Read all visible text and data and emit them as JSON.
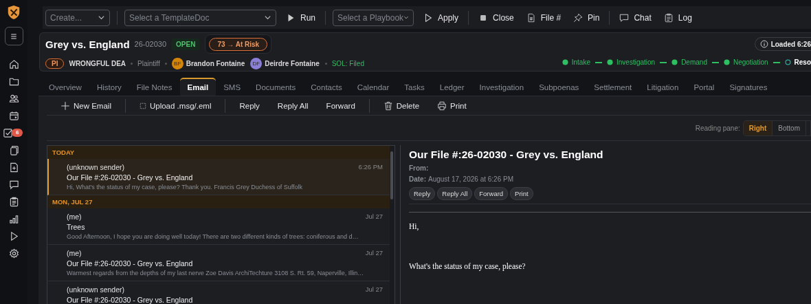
{
  "sidebar": {
    "task_badge": "6"
  },
  "toolbar": {
    "items": [
      {
        "kind": "dropdown",
        "placeholder": "Create..."
      },
      {
        "kind": "divider"
      },
      {
        "kind": "dropdown",
        "placeholder": "Select a TemplateDoc"
      },
      {
        "kind": "button",
        "label": "Run"
      },
      {
        "kind": "divider"
      },
      {
        "kind": "dropdown",
        "placeholder": "Select a Playbook"
      },
      {
        "kind": "button",
        "label": "Apply"
      },
      {
        "kind": "divider"
      },
      {
        "kind": "button",
        "label": "Close"
      },
      {
        "kind": "button",
        "label": "File #"
      },
      {
        "kind": "button",
        "label": "Pin"
      },
      {
        "kind": "divider"
      },
      {
        "kind": "button",
        "label": "Chat"
      },
      {
        "kind": "button",
        "label": "Log"
      }
    ]
  },
  "case": {
    "title": "Grey vs. England",
    "number": "26-02030",
    "status": "OPEN",
    "risk": "73 → At Risk",
    "practice": "PI",
    "case_type": "WRONGFUL DEA",
    "role": "Plaintiff",
    "people": [
      {
        "initials": "BF",
        "name": "Brandon Fontaine",
        "color": "#d4860b"
      },
      {
        "initials": "DF",
        "name": "Deirdre Fontaine",
        "color": "#8a7fd6"
      }
    ],
    "sol": "SOL: Filed",
    "loaded": "Loaded 6:26",
    "stages": [
      {
        "label": "Intake",
        "completed": true
      },
      {
        "label": "Investigation",
        "completed": true
      },
      {
        "label": "Demand",
        "completed": true
      },
      {
        "label": "Negotiation",
        "completed": true
      },
      {
        "label": "Reso",
        "completed": false
      }
    ]
  },
  "tabs": [
    {
      "label": "Overview",
      "selected": false
    },
    {
      "label": "History",
      "selected": false
    },
    {
      "label": "File Notes",
      "selected": false
    },
    {
      "label": "Email",
      "selected": true
    },
    {
      "label": "SMS",
      "selected": false
    },
    {
      "label": "Documents",
      "selected": false
    },
    {
      "label": "Contacts",
      "selected": false
    },
    {
      "label": "Calendar",
      "selected": false
    },
    {
      "label": "Tasks",
      "selected": false
    },
    {
      "label": "Ledger",
      "selected": false
    },
    {
      "label": "Investigation",
      "selected": false
    },
    {
      "label": "Subpoenas",
      "selected": false
    },
    {
      "label": "Settlement",
      "selected": false
    },
    {
      "label": "Litigation",
      "selected": false
    },
    {
      "label": "Portal",
      "selected": false
    },
    {
      "label": "Signatures",
      "selected": false
    }
  ],
  "email_toolbar": [
    {
      "kind": "new",
      "label": "New Email"
    },
    {
      "kind": "divider"
    },
    {
      "kind": "upload",
      "label": "Upload .msg/.eml"
    },
    {
      "kind": "divider"
    },
    {
      "kind": "plain",
      "label": "Reply"
    },
    {
      "kind": "plain",
      "label": "Reply All"
    },
    {
      "kind": "plain",
      "label": "Forward"
    },
    {
      "kind": "divider"
    },
    {
      "kind": "delete",
      "label": "Delete"
    },
    {
      "kind": "print",
      "label": "Print"
    }
  ],
  "reading_pane": {
    "label": "Reading pane:",
    "options": [
      {
        "label": "Right",
        "selected": true
      },
      {
        "label": "Bottom",
        "selected": false
      }
    ]
  },
  "email_groups": [
    {
      "header": "TODAY",
      "emails": [
        {
          "sender": "(unknown sender)",
          "subject": "Our File #:26-02030 - Grey vs. England",
          "preview": "Hi, What's the status of my case, please? Thank you. Francis Grey Duchess of Suffolk",
          "time": "6:26 PM",
          "selected": true
        }
      ]
    },
    {
      "header": "MON, JUL 27",
      "emails": [
        {
          "sender": "(me)",
          "subject": "Trees",
          "preview": "Good Afternoon, I hope you are doing well today! There are two different kinds of trees: coniferous and d…",
          "time": "Jul 27",
          "selected": false
        },
        {
          "sender": "(me)",
          "subject": "Our File #:26-02030 - Grey vs. England",
          "preview": "Warmest regards from the depths of my last nerve Zoe Davis ArchiTechture 3108 S. Rt. 59, Naperville, Illin…",
          "time": "Jul 27",
          "selected": false
        },
        {
          "sender": "(unknown sender)",
          "subject": "Our File #:26-02030 - Grey vs. England",
          "time": "Jul 27",
          "selected": false
        }
      ]
    }
  ],
  "message": {
    "title": "Our File #:26-02030 - Grey vs. England",
    "from_label": "From:",
    "date_label": "Date:",
    "date": "August 17, 2026 at 6:26 PM",
    "actions": [
      "Reply",
      "Reply All",
      "Forward",
      "Print"
    ],
    "body": [
      "Hi,",
      "What's the status of my case, please?"
    ]
  }
}
